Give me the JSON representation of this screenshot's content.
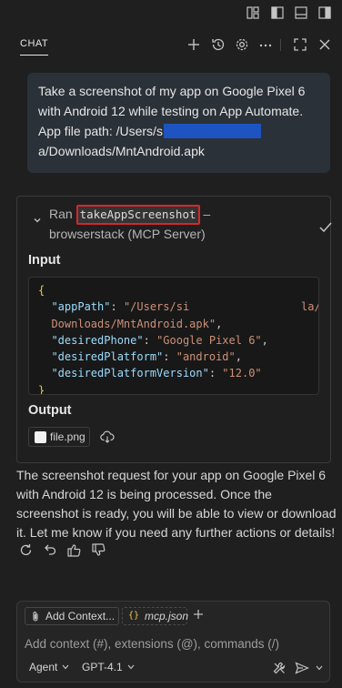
{
  "panel": {
    "title": "CHAT"
  },
  "user_message": {
    "before_redaction": "Take a screenshot of my app on Google Pixel 6 with Android 12 while testing on App Automate. App file path: /Users/s",
    "after_redaction": "a/Downloads/MntAndroid.apk"
  },
  "tool_call": {
    "prefix": "Ran",
    "tool_name": "takeAppScreenshot",
    "dash": "–",
    "server": "browserstack (MCP Server)",
    "input_label": "Input",
    "output_label": "Output",
    "input_json": {
      "open": "{",
      "close": "}",
      "lines": [
        {
          "key": "\"appPath\"",
          "value": "\"/Users/si                 la/",
          "comma": ""
        },
        {
          "key": "",
          "value": "Downloads/MntAndroid.apk\"",
          "comma": ","
        },
        {
          "key": "\"desiredPhone\"",
          "value": "\"Google Pixel 6\"",
          "comma": ","
        },
        {
          "key": "\"desiredPlatform\"",
          "value": "\"android\"",
          "comma": ","
        },
        {
          "key": "\"desiredPlatformVersion\"",
          "value": "\"12.0\"",
          "comma": ""
        }
      ]
    },
    "output_file": "file.png"
  },
  "assistant_message": "The screenshot request for your app on Google Pixel 6 with Android 12 is being processed. Once the screenshot is ready, you will be able to view or download it. Let me know if you need any further actions or details!",
  "composer": {
    "add_context_label": "Add Context...",
    "file_ref": "mcp.json",
    "placeholder": "Add context (#), extensions (@), commands (/)",
    "agent_label": "Agent",
    "model_label": "GPT-4.1"
  },
  "colors": {
    "background": "#1f1f1f",
    "user_bubble": "#2b3138",
    "redaction": "#1e53c2",
    "highlight_border": "#d8262c",
    "json_key": "#9cdcfe",
    "json_string": "#ce9178",
    "json_brace": "#e8c94b"
  },
  "icons": {
    "topbar": [
      "layout-customize-icon",
      "toggle-primary-sidebar-icon",
      "toggle-panel-icon",
      "toggle-secondary-sidebar-icon"
    ],
    "header": [
      "new-chat-icon",
      "history-icon",
      "settings-icon",
      "more-icon",
      "maximize-icon",
      "close-icon"
    ],
    "feedback": [
      "retry-icon",
      "undo-icon",
      "thumbs-up-icon",
      "thumbs-down-icon"
    ]
  }
}
